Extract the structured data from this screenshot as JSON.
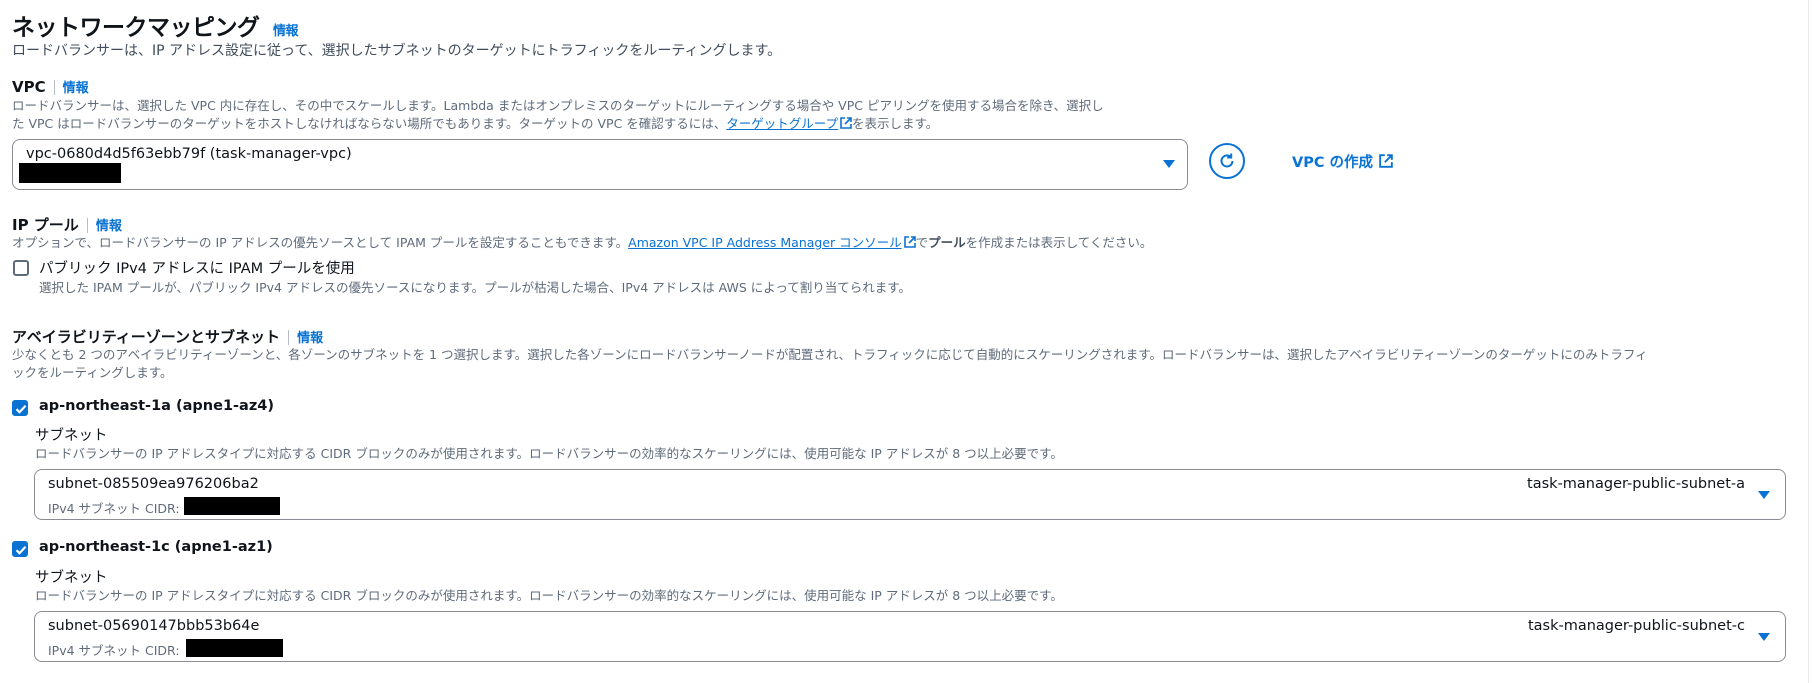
{
  "section": {
    "title": "ネットワークマッピング",
    "info": "情報",
    "description": "ロードバランサーは、IP アドレス設定に従って、選択したサブネットのターゲットにトラフィックをルーティングします。"
  },
  "vpc": {
    "label": "VPC",
    "info": "情報",
    "desc_line1": "ロードバランサーは、選択した VPC 内に存在し、その中でスケールします。Lambda またはオンプレミスのターゲットにルーティングする場合や VPC ピアリングを使用する場合を除き、選択し",
    "desc_line2_pre": "た VPC はロードバランサーのターゲットをホストしなければならない場所でもあります。ターゲットの VPC を確認するには、",
    "desc_link": "ターゲットグループ",
    "desc_line2_post": "を表示します。",
    "selected_value": "vpc-0680d4d5f63ebb79f (task-manager-vpc)",
    "create_label": "VPC の作成"
  },
  "ip_pool": {
    "label": "IP プール",
    "info": "情報",
    "desc_pre": "オプションで、ロードバランサーの IP アドレスの優先ソースとして IPAM プールを設定することもできます。",
    "desc_link": "Amazon VPC IP Address Manager コンソール",
    "desc_mid": "で",
    "desc_bold": "プール",
    "desc_post": "を作成または表示してください。",
    "checkbox_label": "パブリック IPv4 アドレスに IPAM プールを使用",
    "checkbox_checked": false,
    "checkbox_desc": "選択した IPAM プールが、パブリック IPv4 アドレスの優先ソースになります。プールが枯渇した場合、IPv4 アドレスは AWS によって割り当てられます。"
  },
  "az": {
    "label": "アベイラビリティーゾーンとサブネット",
    "info": "情報",
    "desc_line1": "少なくとも 2 つのアベイラビリティーゾーンと、各ゾーンのサブネットを 1 つ選択します。選択した各ゾーンにロードバランサーノードが配置され、トラフィックに応じて自動的にスケーリングされます。ロードバランサーは、選択したアベイラビリティーゾーンのターゲットにのみトラフィ",
    "desc_line2": "ックをルーティングします。",
    "zones": [
      {
        "name": "ap-northeast-1a (apne1-az4)",
        "checked": true,
        "subnet_label": "サブネット",
        "subnet_desc": "ロードバランサーの IP アドレスタイプに対応する CIDR ブロックのみが使用されます。ロードバランサーの効率的なスケーリングには、使用可能な IP アドレスが 8 つ以上必要です。",
        "subnet_id": "subnet-085509ea976206ba2",
        "subnet_name": "task-manager-public-subnet-a",
        "cidr_label": "IPv4 サブネット CIDR:"
      },
      {
        "name": "ap-northeast-1c (apne1-az1)",
        "checked": true,
        "subnet_label": "サブネット",
        "subnet_desc": "ロードバランサーの IP アドレスタイプに対応する CIDR ブロックのみが使用されます。ロードバランサーの効率的なスケーリングには、使用可能な IP アドレスが 8 つ以上必要です。",
        "subnet_id": "subnet-05690147bbb53b64e",
        "subnet_name": "task-manager-public-subnet-c",
        "cidr_label": "IPv4 サブネット CIDR:"
      }
    ]
  },
  "colors": {
    "accent": "#0972d3",
    "text": "#0f141a",
    "muted": "#5f6b7a",
    "border": "#8c8c94"
  }
}
